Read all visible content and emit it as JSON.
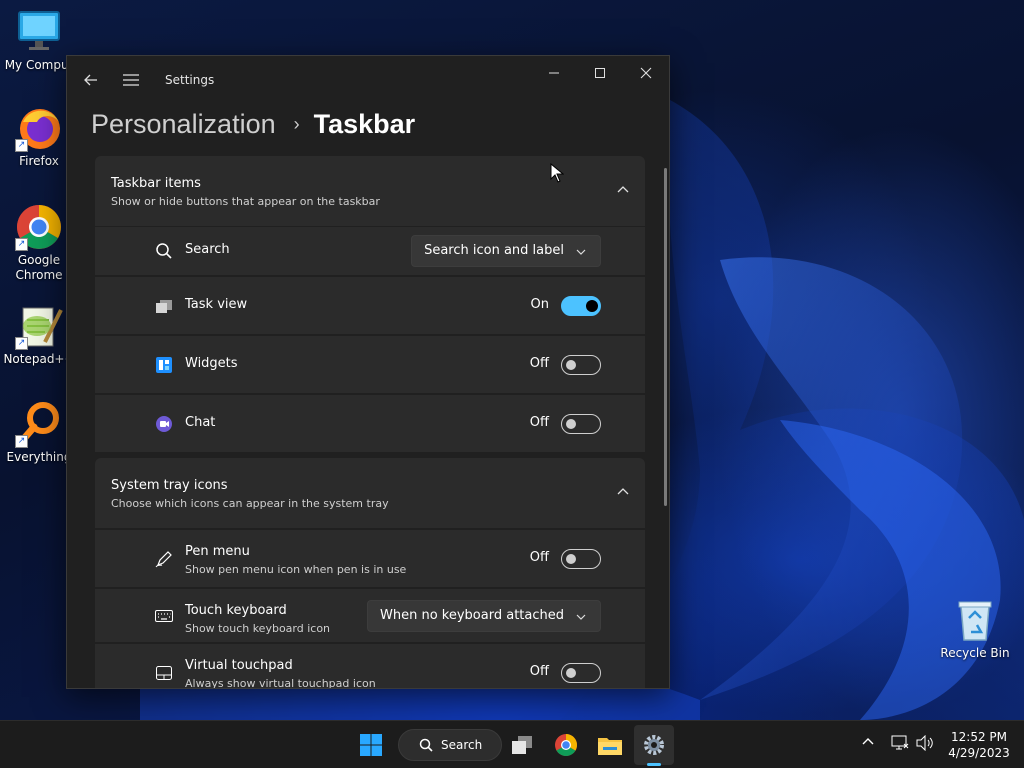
{
  "desktop": {
    "icons": [
      {
        "label": "My Comput",
        "icon": "computer-icon"
      },
      {
        "label": "Firefox",
        "icon": "firefox-icon"
      },
      {
        "label": "Google Chrome",
        "icon": "chrome-icon"
      },
      {
        "label": "Notepad++",
        "icon": "notepadpp-icon"
      },
      {
        "label": "Everything",
        "icon": "everything-icon"
      },
      {
        "label": "Recycle Bin",
        "icon": "recycle-bin-icon"
      }
    ]
  },
  "window": {
    "title": "Settings",
    "breadcrumb": {
      "parent": "Personalization",
      "separator": "›",
      "current": "Taskbar"
    }
  },
  "sections": {
    "taskbar_items": {
      "title": "Taskbar items",
      "subtitle": "Show or hide buttons that appear on the taskbar",
      "rows": [
        {
          "label": "Search",
          "control": "dropdown",
          "value": "Search icon and label",
          "icon": "search-icon"
        },
        {
          "label": "Task view",
          "control": "toggle",
          "state_text": "On",
          "on": true,
          "icon": "task-view-icon"
        },
        {
          "label": "Widgets",
          "control": "toggle",
          "state_text": "Off",
          "on": false,
          "icon": "widgets-icon"
        },
        {
          "label": "Chat",
          "control": "toggle",
          "state_text": "Off",
          "on": false,
          "icon": "chat-icon"
        }
      ]
    },
    "system_tray": {
      "title": "System tray icons",
      "subtitle": "Choose which icons can appear in the system tray",
      "rows": [
        {
          "label": "Pen menu",
          "desc": "Show pen menu icon when pen is in use",
          "control": "toggle",
          "state_text": "Off",
          "on": false,
          "icon": "pen-icon"
        },
        {
          "label": "Touch keyboard",
          "desc": "Show touch keyboard icon",
          "control": "dropdown",
          "value": "When no keyboard attached",
          "icon": "keyboard-icon"
        },
        {
          "label": "Virtual touchpad",
          "desc": "Always show virtual touchpad icon",
          "control": "toggle",
          "state_text": "Off",
          "on": false,
          "icon": "touchpad-icon"
        }
      ]
    }
  },
  "taskbar": {
    "search_label": "Search",
    "clock_time": "12:52 PM",
    "clock_date": "4/29/2023"
  },
  "colors": {
    "accent": "#4cc2ff",
    "window_bg": "#202020",
    "card_bg": "#2b2b2b"
  }
}
